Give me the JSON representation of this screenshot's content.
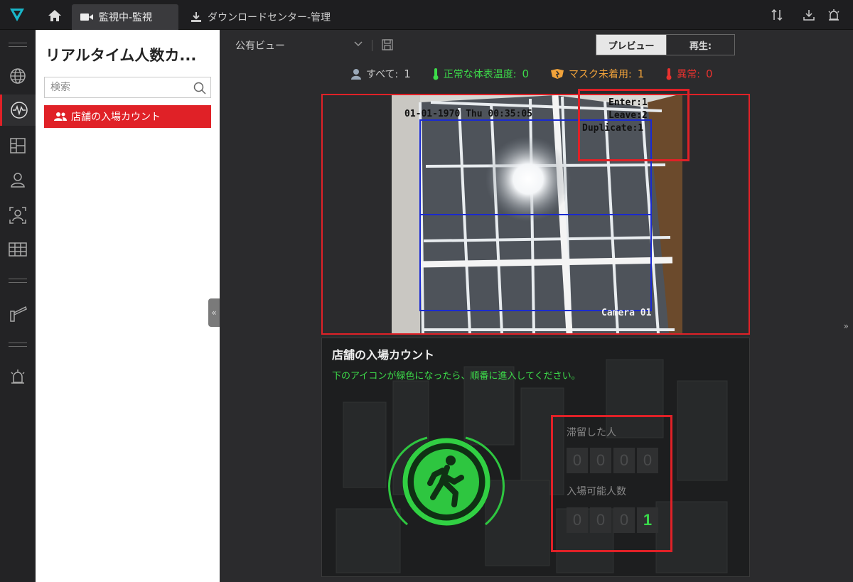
{
  "titlebar": {
    "tabs": [
      {
        "label": "監視中-監視",
        "active": true
      },
      {
        "label": "ダウンロードセンター-管理",
        "active": false
      }
    ]
  },
  "sidebar": {
    "title": "リアルタイム人数カ...",
    "search_placeholder": "検索",
    "items": [
      {
        "label": "店舗の入場カウント",
        "selected": true
      }
    ]
  },
  "toolbar": {
    "view_name": "公有ビュー",
    "preview_label": "プレビュー",
    "playback_label": "再生:"
  },
  "stats": {
    "all_label": "すべて:",
    "all_value": "1",
    "normal_temp_label": "正常な体表温度:",
    "normal_temp_value": "0",
    "no_mask_label": "マスク未着用:",
    "no_mask_value": "1",
    "abnormal_label": "異常:",
    "abnormal_value": "0",
    "colors": {
      "all": "#cccccc",
      "normal": "#3ddc4a",
      "no_mask": "#f0a23a",
      "abnormal": "#e8322f"
    }
  },
  "video": {
    "timestamp": "01-01-1970 Thu 00:35:05",
    "enter": "Enter:1",
    "leave": "Leave:2",
    "duplicate": "Duplicate:1",
    "camera": "Camera 01"
  },
  "count_panel": {
    "title": "店舗の入場カウント",
    "instruction": "下のアイコンが緑色になったら、順番に進入してください。",
    "stayed_label": "滞留した人",
    "stayed_digits": [
      "0",
      "0",
      "0",
      "0"
    ],
    "allowed_label": "入場可能人数",
    "allowed_digits": [
      "0",
      "0",
      "0",
      "1"
    ]
  }
}
